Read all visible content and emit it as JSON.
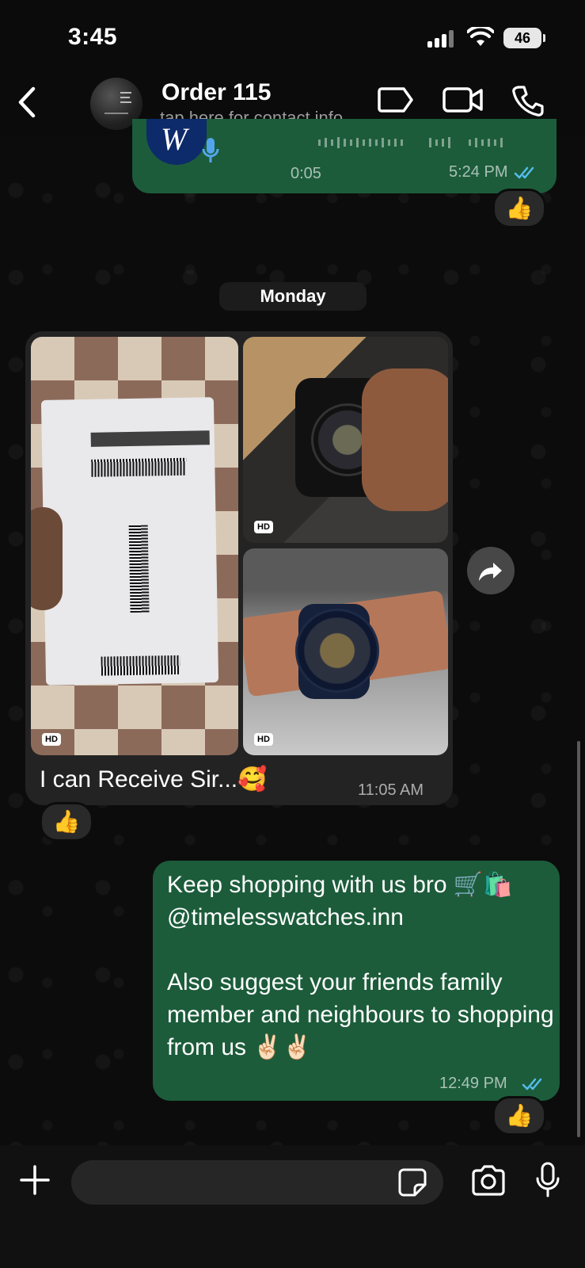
{
  "status_bar": {
    "time": "3:45",
    "battery": "46"
  },
  "header": {
    "contact_name": "Order 115",
    "contact_sub": "tap here for contact info"
  },
  "voice_message": {
    "duration": "0:05",
    "time": "5:24 PM",
    "reaction": "👍"
  },
  "date_separator": "Monday",
  "media_message": {
    "photos": [
      {
        "badge": "HD",
        "description": "package"
      },
      {
        "badge": "HD",
        "description": "watch-in-hand"
      },
      {
        "badge": "HD",
        "description": "watch-on-wrist"
      }
    ],
    "caption": "I can Receive Sir...🥰",
    "time": "11:05 AM",
    "reaction": "👍"
  },
  "outgoing_message": {
    "text": "Keep shopping with us bro 🛒🛍️\n@timelesswatches.inn\n\nAlso suggest your friends family member and neighbours to shopping from us ✌🏻✌🏻",
    "time": "12:49 PM",
    "reaction": "👍"
  },
  "colors": {
    "outgoing_bubble": "#1c5c3b",
    "incoming_bubble": "#232323",
    "read_ticks": "#53bdeb"
  }
}
